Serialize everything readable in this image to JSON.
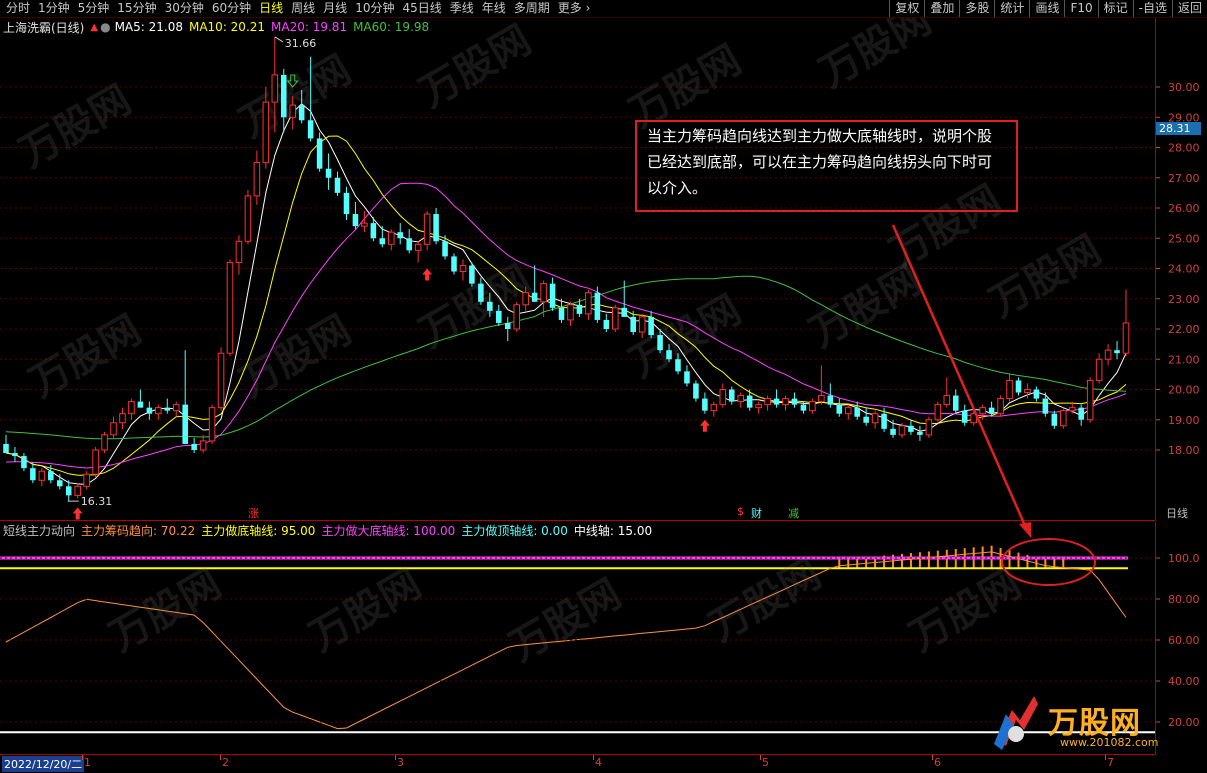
{
  "toolbar": {
    "periods": [
      "分时",
      "1分钟",
      "5分钟",
      "15分钟",
      "30分钟",
      "60分钟",
      "日线",
      "周线",
      "月线",
      "10分钟",
      "45日线",
      "季线",
      "年线",
      "多周期",
      "更多"
    ],
    "active_period": "日线",
    "right_buttons": [
      "复权",
      "叠加",
      "多股",
      "统计",
      "画线",
      "F10",
      "标记",
      "-自选",
      "返回"
    ]
  },
  "stock": {
    "name": "上海洗霸(日线)"
  },
  "ma_header": {
    "ma5": "MA5: 21.08",
    "ma10": "MA10: 20.21",
    "ma20": "MA20: 19.81",
    "ma60": "MA60: 19.98"
  },
  "price_axis": {
    "labels": [
      "30.00",
      "29.00",
      "28.00",
      "27.00",
      "26.00",
      "25.00",
      "24.00",
      "23.00",
      "22.00",
      "21.00",
      "20.00",
      "19.00",
      "18.00"
    ],
    "current": "28.31",
    "period_label": "日线"
  },
  "high_label": "31.66",
  "low_label": "16.31",
  "event_tags": [
    "涨",
    "$",
    "财",
    "减"
  ],
  "indicator": {
    "title": "短线主力动向",
    "line1": "主力筹码趋向: 70.22",
    "line2": "主力做底轴线: 95.00",
    "line3": "主力做大底轴线: 100.00",
    "line4": "主力做顶轴线: 0.00",
    "line5": "中线轴: 15.00",
    "axis_labels": [
      "100.0",
      "80.00",
      "60.00",
      "40.00",
      "20.00"
    ]
  },
  "date_axis": {
    "start": "2022/12/20/二",
    "months": [
      "1",
      "2",
      "3",
      "4",
      "5",
      "6",
      "7"
    ]
  },
  "annotation": {
    "text": "当主力筹码趋向线达到主力做大底轴线时，说明个股已经达到底部，可以在主力筹码趋向线拐头向下时可以介入。"
  },
  "logo": {
    "text": "万股网",
    "url": "www.201082.com"
  },
  "colors": {
    "up": "#ff3030",
    "down": "#54ffff",
    "ma5": "#ffffff",
    "ma10": "#ffff00",
    "ma20": "#ff40ff",
    "ma60": "#40c040"
  },
  "chart_data": {
    "type": "candlestick",
    "title": "上海洗霸(日线)",
    "candles": [
      [
        18.2,
        18.5,
        17.9,
        17.9
      ],
      [
        17.9,
        18.1,
        17.6,
        17.8
      ],
      [
        17.8,
        17.9,
        17.3,
        17.4
      ],
      [
        17.4,
        17.6,
        16.9,
        17.0
      ],
      [
        17.0,
        17.4,
        16.8,
        17.3
      ],
      [
        17.3,
        17.5,
        16.9,
        17.0
      ],
      [
        17.0,
        17.2,
        16.7,
        16.8
      ],
      [
        16.8,
        17.0,
        16.3,
        16.5
      ],
      [
        16.5,
        16.9,
        16.4,
        16.8
      ],
      [
        16.8,
        17.3,
        16.7,
        17.2
      ],
      [
        17.2,
        18.1,
        17.1,
        18.0
      ],
      [
        18.0,
        18.6,
        17.9,
        18.5
      ],
      [
        18.5,
        19.1,
        18.4,
        18.9
      ],
      [
        18.9,
        19.4,
        18.7,
        19.2
      ],
      [
        19.2,
        19.7,
        19.0,
        19.6
      ],
      [
        19.6,
        20.0,
        19.4,
        19.4
      ],
      [
        19.4,
        19.6,
        19.0,
        19.2
      ],
      [
        19.2,
        19.5,
        19.0,
        19.4
      ],
      [
        19.4,
        19.7,
        19.2,
        19.3
      ],
      [
        19.3,
        19.6,
        19.1,
        19.5
      ],
      [
        19.5,
        21.3,
        18.2,
        18.2
      ],
      [
        18.2,
        18.4,
        17.9,
        18.0
      ],
      [
        18.0,
        18.5,
        17.9,
        18.3
      ],
      [
        18.3,
        19.5,
        18.2,
        19.4
      ],
      [
        19.4,
        21.4,
        19.3,
        21.2
      ],
      [
        21.2,
        24.3,
        21.1,
        24.2
      ],
      [
        24.2,
        25.1,
        23.8,
        24.9
      ],
      [
        24.9,
        26.6,
        24.8,
        26.4
      ],
      [
        26.4,
        27.9,
        26.1,
        27.5
      ],
      [
        27.5,
        30.0,
        27.3,
        29.5
      ],
      [
        29.5,
        31.66,
        28.5,
        30.4
      ],
      [
        30.4,
        30.6,
        28.5,
        29.0
      ],
      [
        29.0,
        29.7,
        28.6,
        29.4
      ],
      [
        29.4,
        29.9,
        28.8,
        28.9
      ],
      [
        28.9,
        31.0,
        28.2,
        28.3
      ],
      [
        28.3,
        28.5,
        27.2,
        27.3
      ],
      [
        27.3,
        27.8,
        26.6,
        27.0
      ],
      [
        27.0,
        27.2,
        26.4,
        26.5
      ],
      [
        26.5,
        26.7,
        25.6,
        25.8
      ],
      [
        25.8,
        26.2,
        25.3,
        25.4
      ],
      [
        25.4,
        25.9,
        25.2,
        25.5
      ],
      [
        25.5,
        25.7,
        24.9,
        25.0
      ],
      [
        25.0,
        25.4,
        24.7,
        24.8
      ],
      [
        24.8,
        25.3,
        24.6,
        25.2
      ],
      [
        25.2,
        25.5,
        24.8,
        25.0
      ],
      [
        25.0,
        25.3,
        24.5,
        24.6
      ],
      [
        24.6,
        24.9,
        24.2,
        24.8
      ],
      [
        24.8,
        25.9,
        24.6,
        25.8
      ],
      [
        25.8,
        26.0,
        24.8,
        24.9
      ],
      [
        24.9,
        25.1,
        24.3,
        24.4
      ],
      [
        24.4,
        24.5,
        23.8,
        23.9
      ],
      [
        23.9,
        24.3,
        23.6,
        24.1
      ],
      [
        24.1,
        24.2,
        23.4,
        23.5
      ],
      [
        23.5,
        23.7,
        22.8,
        22.9
      ],
      [
        22.9,
        23.2,
        22.4,
        22.6
      ],
      [
        22.6,
        22.8,
        22.1,
        22.2
      ],
      [
        22.2,
        22.4,
        21.6,
        22.0
      ],
      [
        22.0,
        22.9,
        21.9,
        22.8
      ],
      [
        22.8,
        23.4,
        22.6,
        23.2
      ],
      [
        23.2,
        24.1,
        22.9,
        22.9
      ],
      [
        22.9,
        23.6,
        22.4,
        23.5
      ],
      [
        23.5,
        23.7,
        22.6,
        22.7
      ],
      [
        22.7,
        23.0,
        22.2,
        22.3
      ],
      [
        22.3,
        22.9,
        22.1,
        22.8
      ],
      [
        22.8,
        23.0,
        22.4,
        22.5
      ],
      [
        22.5,
        23.3,
        22.3,
        23.2
      ],
      [
        23.2,
        23.4,
        22.2,
        22.3
      ],
      [
        22.3,
        22.5,
        21.9,
        22.0
      ],
      [
        22.0,
        22.8,
        21.9,
        22.7
      ],
      [
        22.7,
        23.6,
        22.6,
        22.4
      ],
      [
        22.4,
        22.6,
        21.8,
        21.9
      ],
      [
        21.9,
        22.5,
        21.7,
        22.4
      ],
      [
        22.4,
        22.6,
        21.7,
        21.8
      ],
      [
        21.8,
        22.0,
        21.2,
        21.3
      ],
      [
        21.3,
        21.5,
        20.9,
        21.0
      ],
      [
        21.0,
        21.2,
        20.5,
        20.6
      ],
      [
        20.6,
        20.8,
        20.1,
        20.2
      ],
      [
        20.2,
        20.3,
        19.6,
        19.7
      ],
      [
        19.7,
        19.9,
        19.2,
        19.3
      ],
      [
        19.3,
        19.6,
        19.1,
        19.5
      ],
      [
        19.5,
        20.2,
        19.4,
        20.0
      ],
      [
        20.0,
        20.1,
        19.5,
        19.6
      ],
      [
        19.6,
        19.9,
        19.4,
        19.8
      ],
      [
        19.8,
        20.0,
        19.3,
        19.4
      ],
      [
        19.4,
        19.6,
        19.2,
        19.5
      ],
      [
        19.5,
        19.8,
        19.3,
        19.7
      ],
      [
        19.7,
        20.0,
        19.4,
        19.5
      ],
      [
        19.5,
        19.8,
        19.3,
        19.7
      ],
      [
        19.7,
        19.9,
        19.4,
        19.5
      ],
      [
        19.5,
        19.6,
        19.2,
        19.3
      ],
      [
        19.3,
        19.7,
        19.2,
        19.6
      ],
      [
        19.6,
        20.8,
        19.5,
        19.8
      ],
      [
        19.8,
        20.2,
        19.4,
        19.5
      ],
      [
        19.5,
        19.7,
        19.1,
        19.2
      ],
      [
        19.2,
        19.5,
        19.0,
        19.4
      ],
      [
        19.4,
        19.6,
        19.0,
        19.1
      ],
      [
        19.1,
        19.4,
        18.8,
        18.9
      ],
      [
        18.9,
        19.3,
        18.7,
        19.2
      ],
      [
        19.2,
        19.4,
        18.6,
        18.7
      ],
      [
        18.7,
        19.0,
        18.4,
        18.5
      ],
      [
        18.5,
        18.9,
        18.4,
        18.8
      ],
      [
        18.8,
        19.0,
        18.5,
        18.6
      ],
      [
        18.6,
        18.8,
        18.3,
        18.5
      ],
      [
        18.5,
        19.1,
        18.4,
        19.0
      ],
      [
        19.0,
        19.6,
        18.9,
        19.5
      ],
      [
        19.5,
        20.4,
        19.4,
        19.8
      ],
      [
        19.8,
        20.0,
        19.2,
        19.3
      ],
      [
        19.3,
        19.5,
        18.8,
        18.9
      ],
      [
        18.9,
        19.3,
        18.8,
        19.2
      ],
      [
        19.2,
        19.5,
        19.0,
        19.4
      ],
      [
        19.4,
        19.6,
        19.1,
        19.2
      ],
      [
        19.2,
        19.8,
        19.1,
        19.7
      ],
      [
        19.7,
        20.5,
        19.6,
        20.3
      ],
      [
        20.3,
        20.4,
        19.8,
        19.9
      ],
      [
        19.9,
        20.2,
        19.7,
        20.0
      ],
      [
        20.0,
        20.1,
        19.6,
        19.7
      ],
      [
        19.7,
        19.9,
        19.1,
        19.2
      ],
      [
        19.2,
        19.3,
        18.7,
        18.8
      ],
      [
        18.8,
        19.4,
        18.7,
        19.3
      ],
      [
        19.3,
        19.6,
        19.2,
        19.4
      ],
      [
        19.4,
        19.5,
        18.8,
        19.0
      ],
      [
        19.0,
        20.4,
        18.9,
        20.3
      ],
      [
        20.3,
        21.2,
        20.2,
        21.0
      ],
      [
        21.0,
        21.5,
        20.8,
        21.3
      ],
      [
        21.3,
        21.6,
        21.0,
        21.2
      ],
      [
        21.2,
        23.3,
        21.1,
        22.2
      ]
    ],
    "high": 31.66,
    "low": 16.31,
    "ylim": [
      16.0,
      32.0
    ],
    "indicator_ylim": [
      5,
      115
    ]
  }
}
